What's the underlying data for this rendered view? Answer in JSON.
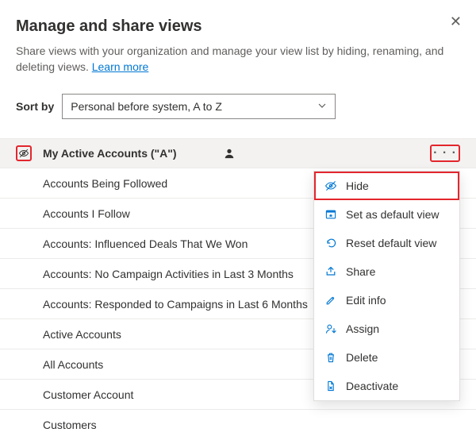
{
  "header": {
    "title": "Manage and share views",
    "close_label": "✕",
    "description": "Share views with your organization and manage your view list by hiding, renaming, and deleting views.",
    "learn_more": "Learn more"
  },
  "sort": {
    "label": "Sort by",
    "selected": "Personal before system, A to Z"
  },
  "views": [
    "My Active Accounts (\"A\")",
    "Accounts Being Followed",
    "Accounts I Follow",
    "Accounts: Influenced Deals That We Won",
    "Accounts: No Campaign Activities in Last 3 Months",
    "Accounts: Responded to Campaigns in Last 6 Months",
    "Active Accounts",
    "All Accounts",
    "Customer Account",
    "Customers"
  ],
  "menu": {
    "hide": "Hide",
    "set_default": "Set as default view",
    "reset_default": "Reset default view",
    "share": "Share",
    "edit_info": "Edit info",
    "assign": "Assign",
    "delete": "Delete",
    "deactivate": "Deactivate"
  }
}
